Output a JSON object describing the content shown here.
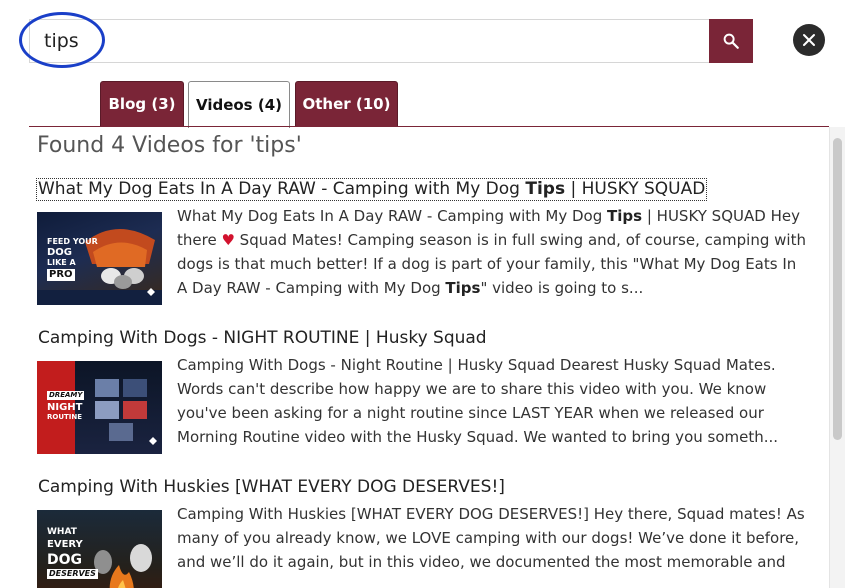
{
  "search": {
    "value": "tips"
  },
  "tabs": [
    {
      "label": "Blog (3)",
      "active": false
    },
    {
      "label": "Videos (4)",
      "active": true
    },
    {
      "label": "Other (10)",
      "active": false
    }
  ],
  "results": {
    "heading": "Found 4 Videos for 'tips'",
    "items": [
      {
        "title_pre": "What My Dog Eats In A Day RAW - Camping with My Dog ",
        "title_highlight": "Tips",
        "title_post": " | HUSKY SQUAD",
        "thumb_lines": [
          "FEED YOUR",
          "DOG",
          "LIKE A",
          "PRO"
        ],
        "snippet_parts": [
          {
            "t": "What My Dog Eats In A Day RAW - Camping with My Dog "
          },
          {
            "t": "Tips",
            "b": true
          },
          {
            "t": " | HUSKY SQUAD Hey there "
          },
          {
            "t": "♥",
            "heart": true
          },
          {
            "t": " Squad Mates! Camping season is in full swing and, of course, camping with dogs is that much better! If a dog is part of your family, this \"What My Dog Eats In A Day RAW - Camping with My Dog "
          },
          {
            "t": "Tips",
            "b": true
          },
          {
            "t": "\" video is going to s..."
          }
        ]
      },
      {
        "title_pre": "Camping With Dogs - NIGHT ROUTINE | Husky Squad",
        "title_highlight": "",
        "title_post": "",
        "thumb_lines": [
          "DREAMY",
          "NIGHT",
          "ROUTINE"
        ],
        "snippet_parts": [
          {
            "t": "Camping With Dogs - Night Routine | Husky Squad Dearest Husky Squad Mates. Words can't describe how happy we are to share this video with you. We know you've been asking for a night routine since LAST YEAR when we released our Morning Routine video with the Husky Squad. We wanted to bring you someth..."
          }
        ]
      },
      {
        "title_pre": "Camping With Huskies [WHAT EVERY DOG DESERVES!]",
        "title_highlight": "",
        "title_post": "",
        "thumb_lines": [
          "WHAT",
          "EVERY",
          "DOG",
          "DESERVES"
        ],
        "snippet_parts": [
          {
            "t": "Camping With Huskies [WHAT EVERY DOG DESERVES!] Hey there, Squad mates! As many of you already know, we LOVE camping with our dogs! We’ve done it before, and we’ll do it again, but in this video, we documented the most memorable and"
          }
        ]
      }
    ]
  },
  "colors": {
    "accent": "#7a2537",
    "annotation_circle": "#1a3fc8",
    "heart": "#d2122e"
  },
  "icons": {
    "search_button": "search-icon",
    "close_button": "close-icon"
  }
}
